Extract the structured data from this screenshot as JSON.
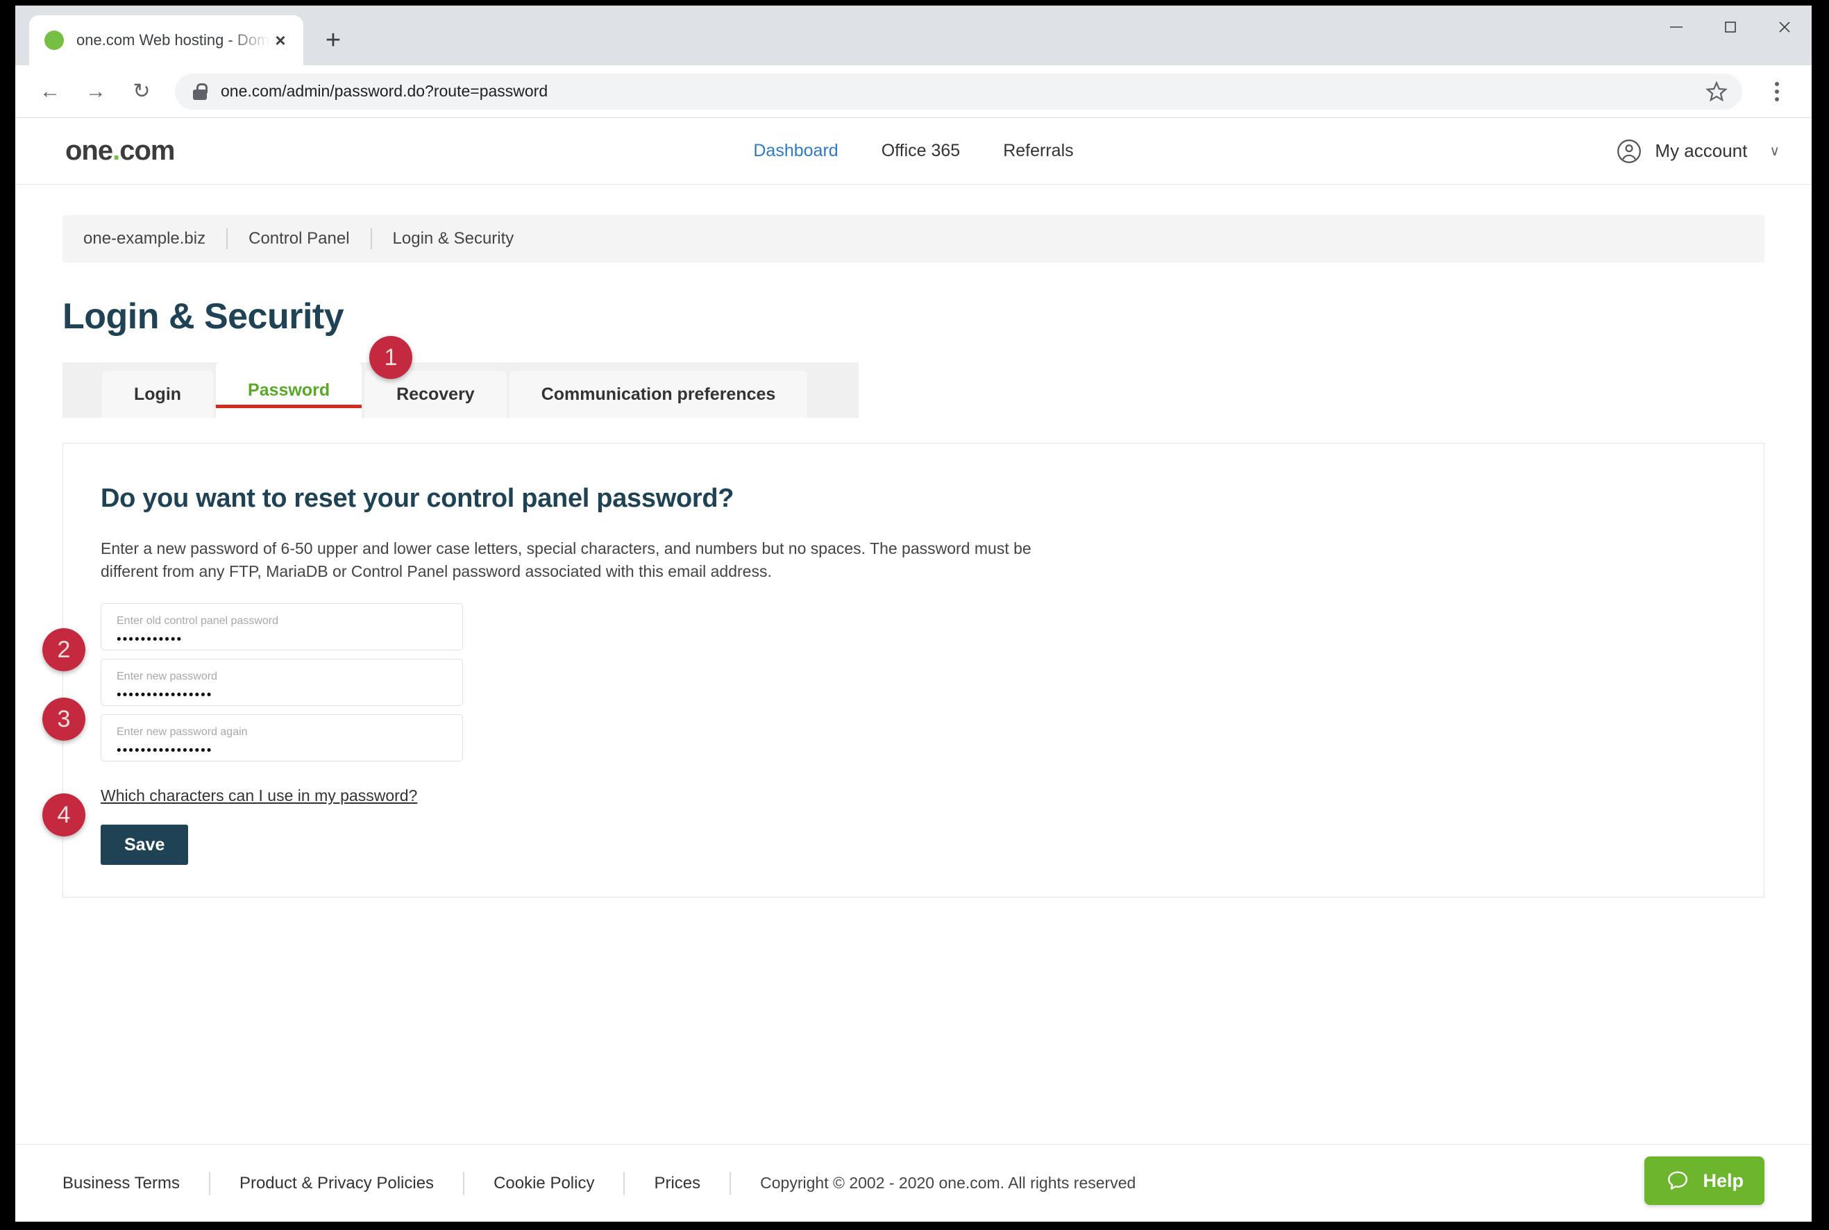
{
  "browser": {
    "tab": {
      "title": "one.com Web hosting  -  Domain",
      "favicon": "circle-green-icon",
      "close": "×"
    },
    "new_tab": "+",
    "window_controls": {
      "minimize": "minimize-icon",
      "maximize": "maximize-icon",
      "close": "close-icon"
    },
    "nav": {
      "back": "←",
      "forward": "→",
      "reload": "↻"
    },
    "url": "one.com/admin/password.do?route=password",
    "lock": "lock-icon",
    "bookmark": "star-icon",
    "menu": "kebab-menu-icon"
  },
  "site_header": {
    "logo": {
      "text_a": "one",
      "dot": ".",
      "text_b": "com"
    },
    "nav_items": [
      {
        "label": "Dashboard",
        "active": true
      },
      {
        "label": "Office 365",
        "active": false
      },
      {
        "label": "Referrals",
        "active": false
      }
    ],
    "account": {
      "label": "My account",
      "icon": "user-circle-icon",
      "chevron": "∨"
    }
  },
  "breadcrumb": [
    "one-example.biz",
    "Control Panel",
    "Login & Security"
  ],
  "page_title": "Login & Security",
  "tabs": [
    {
      "label": "Login",
      "active": false
    },
    {
      "label": "Password",
      "active": true
    },
    {
      "label": "Recovery",
      "active": false
    },
    {
      "label": "Communication preferences",
      "active": false
    }
  ],
  "card": {
    "heading": "Do you want to reset your control panel password?",
    "description": "Enter a new password of 6-50 upper and lower case letters, special characters, and numbers but no spaces. The password must be different from any FTP, MariaDB or Control Panel password associated with this email address.",
    "fields": [
      {
        "label": "Enter old control panel password",
        "value": "•••••••••••"
      },
      {
        "label": "Enter new password",
        "value": "••••••••••••••••"
      },
      {
        "label": "Enter new password again",
        "value": "••••••••••••••••"
      }
    ],
    "help_link": "Which characters can I use in my password?",
    "save_label": "Save"
  },
  "annotations": [
    {
      "number": "1"
    },
    {
      "number": "2"
    },
    {
      "number": "3"
    },
    {
      "number": "4"
    }
  ],
  "footer": {
    "links": [
      "Business Terms",
      "Product & Privacy Policies",
      "Cookie Policy",
      "Prices"
    ],
    "copyright": "Copyright © 2002 - 2020 one.com. All rights reserved",
    "help_button": {
      "label": "Help",
      "icon": "chat-bubble-icon"
    }
  },
  "colors": {
    "brand_green": "#74bf44",
    "accent_dark": "#1f4355",
    "annotation_red": "#c4293f",
    "tab_active_green": "#5aa829",
    "underline_red": "#d52b1e",
    "help_green": "#6cb52d",
    "nav_active_blue": "#2e7bc4"
  }
}
